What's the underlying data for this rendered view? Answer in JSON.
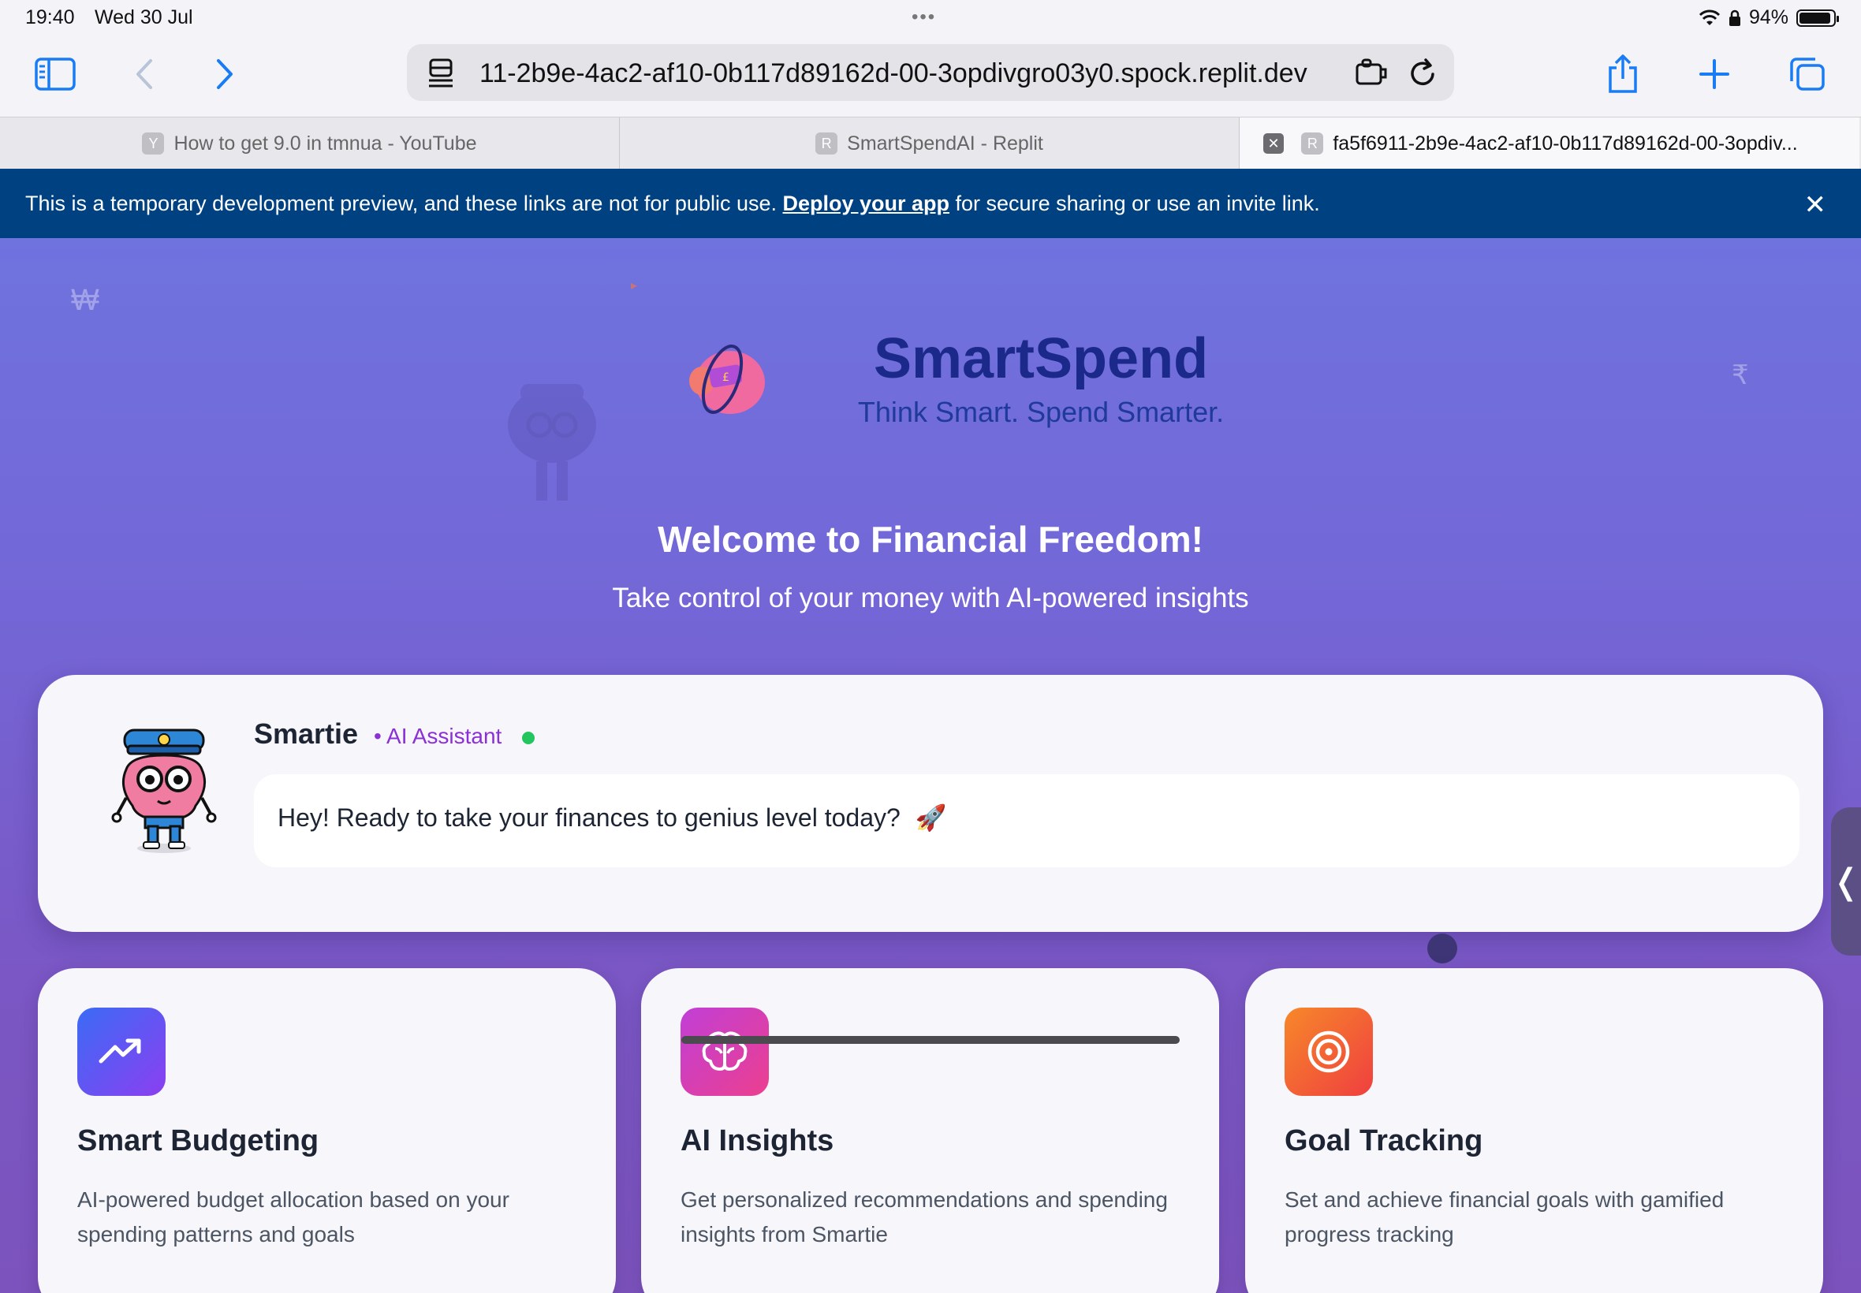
{
  "status_bar": {
    "time": "19:40",
    "date": "Wed 30 Jul",
    "battery": "94%",
    "battery_level": 0.94
  },
  "browser": {
    "address": "11-2b9e-4ac2-af10-0b117d89162d-00-3opdivgro03y0.spock.replit.dev",
    "tabs": [
      {
        "favicon": "Y",
        "title": "How to get 9.0 in tmnua - YouTube"
      },
      {
        "favicon": "R",
        "title": "SmartSpendAI - Replit"
      },
      {
        "favicon": "R",
        "title": "fa5f6911-2b9e-4ac2-af10-0b117d89162d-00-3opdiv..."
      }
    ]
  },
  "banner": {
    "text_before": "This is a temporary development preview, and these links are not for public use. ",
    "link": "Deploy your app",
    "text_after": " for secure sharing or use an invite link.",
    "close": "✕"
  },
  "hero": {
    "title": "SmartSpend",
    "tagline": "Think Smart. Spend Smarter.",
    "welcome": "Welcome to Financial Freedom!",
    "subtitle": "Take control of your money with AI-powered insights"
  },
  "assistant": {
    "name": "Smartie",
    "role": "• AI Assistant",
    "message": "Hey! Ready to take your finances to genius level today?",
    "emoji": "🚀"
  },
  "features": [
    {
      "title": "Smart Budgeting",
      "description": "AI-powered budget allocation based on your spending patterns and goals",
      "icon": "trending-up-icon"
    },
    {
      "title": "AI Insights",
      "description": "Get personalized recommendations and spending insights from Smartie",
      "icon": "brain-icon"
    },
    {
      "title": "Goal Tracking",
      "description": "Set and achieve financial goals with gamified progress tracking",
      "icon": "target-icon"
    }
  ],
  "colors": {
    "banner": "#004182",
    "brand": "#1b2a8a",
    "accent_purple": "#8b2fd6",
    "online": "#22c55e"
  }
}
